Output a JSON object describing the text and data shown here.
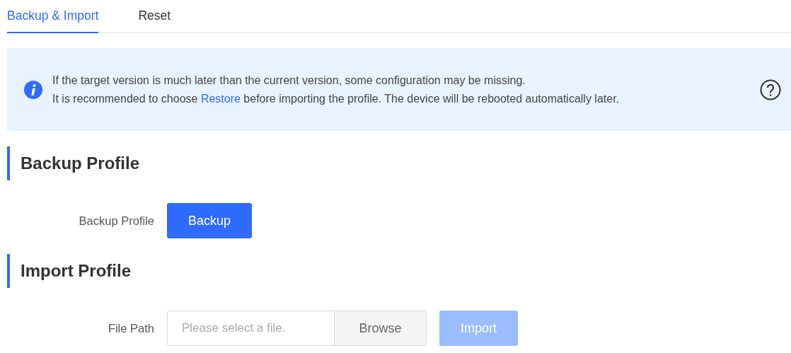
{
  "tabs": [
    {
      "label": "Backup & Import",
      "selected": true
    },
    {
      "label": "Reset",
      "selected": false
    }
  ],
  "notice": {
    "lines": [
      {
        "kind": "plain",
        "text": "If the target version is much later than the current version, some configuration may be missing."
      },
      {
        "kind": "link",
        "before": "It is recommended to choose ",
        "link": "Restore",
        "after": " before importing the profile. The device will be rebooted automatically later."
      }
    ]
  },
  "sections": [
    {
      "title": "Backup Profile",
      "rows": [
        {
          "kind": "button",
          "label": "Backup Profile",
          "button": {
            "label": "Backup",
            "disabled": false
          }
        }
      ]
    },
    {
      "title": "Import Profile",
      "rows": [
        {
          "kind": "file",
          "label": "File Path",
          "placeholder": "Please select a file.",
          "browse": "Browse",
          "button": {
            "label": "Import",
            "disabled": true
          }
        }
      ]
    }
  ]
}
